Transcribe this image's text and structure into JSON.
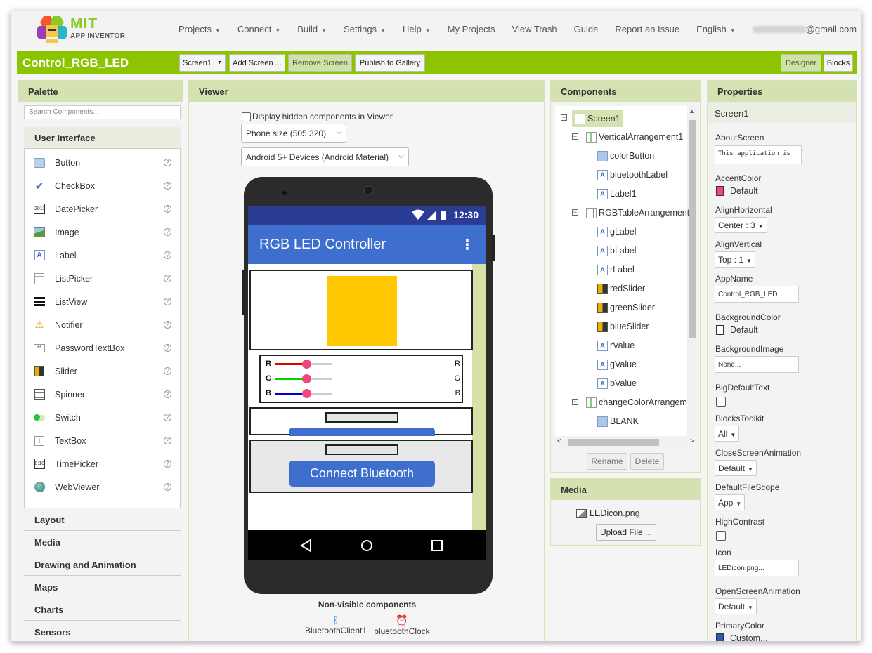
{
  "topnav": {
    "logo_mit": "MIT",
    "logo_app_inventor": "APP INVENTOR",
    "items": [
      {
        "label": "Projects",
        "caret": true
      },
      {
        "label": "Connect",
        "caret": true
      },
      {
        "label": "Build",
        "caret": true
      },
      {
        "label": "Settings",
        "caret": true
      },
      {
        "label": "Help",
        "caret": true
      },
      {
        "label": "My Projects",
        "caret": false
      },
      {
        "label": "View Trash",
        "caret": false
      },
      {
        "label": "Guide",
        "caret": false
      },
      {
        "label": "Report an Issue",
        "caret": false
      },
      {
        "label": "English",
        "caret": true
      }
    ],
    "account_suffix": "@gmail.com"
  },
  "projectbar": {
    "project_name": "Control_RGB_LED",
    "screen_select": "Screen1",
    "add_screen": "Add Screen ...",
    "remove_screen": "Remove Screen",
    "publish": "Publish to Gallery",
    "designer": "Designer",
    "blocks": "Blocks"
  },
  "palette": {
    "title": "Palette",
    "search_placeholder": "Search Components...",
    "open_category": "User Interface",
    "items": [
      {
        "label": "Button",
        "icon": "button-icon"
      },
      {
        "label": "CheckBox",
        "icon": "checkbox-icon"
      },
      {
        "label": "DatePicker",
        "icon": "datepicker-icon"
      },
      {
        "label": "Image",
        "icon": "image-icon"
      },
      {
        "label": "Label",
        "icon": "label-icon"
      },
      {
        "label": "ListPicker",
        "icon": "listpicker-icon"
      },
      {
        "label": "ListView",
        "icon": "listview-icon"
      },
      {
        "label": "Notifier",
        "icon": "notifier-icon"
      },
      {
        "label": "PasswordTextBox",
        "icon": "password-icon"
      },
      {
        "label": "Slider",
        "icon": "slider-icon"
      },
      {
        "label": "Spinner",
        "icon": "spinner-icon"
      },
      {
        "label": "Switch",
        "icon": "switch-icon"
      },
      {
        "label": "TextBox",
        "icon": "textbox-icon"
      },
      {
        "label": "TimePicker",
        "icon": "timepicker-icon"
      },
      {
        "label": "WebViewer",
        "icon": "webviewer-icon"
      }
    ],
    "categories": [
      "Layout",
      "Media",
      "Drawing and Animation",
      "Maps",
      "Charts",
      "Sensors"
    ],
    "help_glyph": "?"
  },
  "viewer": {
    "title": "Viewer",
    "hidden_checkbox_label": "Display hidden components in Viewer",
    "phone_size": "Phone size (505,320)",
    "theme": "Android 5+ Devices (Android Material)",
    "status_time": "12:30",
    "app_title": "RGB LED Controller",
    "slider_labels": [
      "R",
      "G",
      "B"
    ],
    "slider_colors": [
      "#e00000",
      "#00d000",
      "#0000d0"
    ],
    "connect_button": "Connect Bluetooth",
    "nonvisible_title": "Non-visible components",
    "nonvisible": [
      "BluetoothClient1",
      "bluetoothClock"
    ]
  },
  "components": {
    "title": "Components",
    "tree": [
      {
        "label": "Screen1",
        "icon": "screen",
        "toggle": "−",
        "selected": true
      },
      {
        "label": "VerticalArrangement1",
        "icon": "arrangement",
        "toggle": "−"
      },
      {
        "label": "colorButton",
        "icon": "button"
      },
      {
        "label": "bluetoothLabel",
        "icon": "label"
      },
      {
        "label": "Label1",
        "icon": "label"
      },
      {
        "label": "RGBTableArrangement",
        "icon": "table",
        "toggle": "−"
      },
      {
        "label": "gLabel",
        "icon": "label"
      },
      {
        "label": "bLabel",
        "icon": "label"
      },
      {
        "label": "rLabel",
        "icon": "label"
      },
      {
        "label": "redSlider",
        "icon": "slider"
      },
      {
        "label": "greenSlider",
        "icon": "slider"
      },
      {
        "label": "blueSlider",
        "icon": "slider"
      },
      {
        "label": "rValue",
        "icon": "label"
      },
      {
        "label": "gValue",
        "icon": "label"
      },
      {
        "label": "bValue",
        "icon": "label"
      },
      {
        "label": "changeColorArrangem",
        "icon": "arrangement",
        "toggle": "−"
      },
      {
        "label": "BLANK",
        "icon": "horizontal"
      }
    ],
    "rename": "Rename",
    "delete": "Delete"
  },
  "media": {
    "title": "Media",
    "file": "LEDicon.png",
    "upload": "Upload File ..."
  },
  "properties": {
    "title": "Properties",
    "component": "Screen1",
    "about_screen_label": "AboutScreen",
    "about_screen_value": "This application is",
    "accent_color_label": "AccentColor",
    "accent_color_value": "Default",
    "accent_color_swatch": "#f0467a",
    "align_h_label": "AlignHorizontal",
    "align_h_value": "Center : 3",
    "align_v_label": "AlignVertical",
    "align_v_value": "Top : 1",
    "app_name_label": "AppName",
    "app_name_value": "Control_RGB_LED",
    "bg_color_label": "BackgroundColor",
    "bg_color_value": "Default",
    "bg_image_label": "BackgroundImage",
    "bg_image_value": "None...",
    "big_text_label": "BigDefaultText",
    "blocks_toolkit_label": "BlocksToolkit",
    "blocks_toolkit_value": "All",
    "close_anim_label": "CloseScreenAnimation",
    "close_anim_value": "Default",
    "file_scope_label": "DefaultFileScope",
    "file_scope_value": "App",
    "high_contrast_label": "HighContrast",
    "icon_label": "Icon",
    "icon_value": "LEDicon.png...",
    "open_anim_label": "OpenScreenAnimation",
    "open_anim_value": "Default",
    "primary_color_label": "PrimaryColor",
    "primary_color_value": "Custom...",
    "primary_color_swatch": "#2f56c0"
  },
  "colors": {
    "brand_green": "#8cc400",
    "panel_header": "#d4e2b1",
    "led_color": "#ffc800",
    "app_bar": "#3f6fce"
  }
}
